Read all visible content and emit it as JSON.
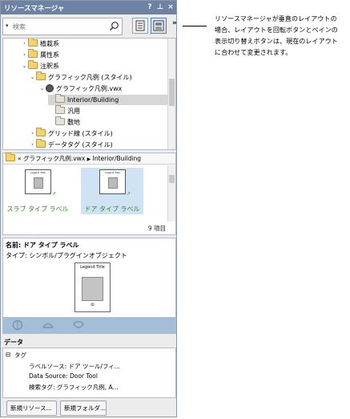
{
  "window": {
    "title": "リソースマネージャ",
    "help_label": "?",
    "pin_label": "⊥",
    "close_label": "×",
    "overflow_label": "»"
  },
  "search": {
    "dropdown_glyph": "▾",
    "placeholder": "検索",
    "value": ""
  },
  "tree": {
    "items": [
      {
        "label": "植栽系",
        "arrow": "›",
        "icon": "folder"
      },
      {
        "label": "属性系",
        "arrow": "›",
        "icon": "folder"
      },
      {
        "label": "注釈系",
        "arrow": "⌄",
        "icon": "folder"
      },
      {
        "label": "グラフィック凡例 (スタイル)",
        "arrow": "⌄",
        "icon": "folder"
      },
      {
        "label": "グラフィック凡例.vwx",
        "arrow": "⌄",
        "icon": "file"
      },
      {
        "label": "Interior/Building",
        "arrow": "",
        "icon": "folder-grey"
      },
      {
        "label": "汎用",
        "arrow": "",
        "icon": "folder-grey"
      },
      {
        "label": "敷地",
        "arrow": "",
        "icon": "folder-grey"
      },
      {
        "label": "グリッド線 (スタイル)",
        "arrow": "›",
        "icon": "folder"
      },
      {
        "label": "データタグ (スタイル)",
        "arrow": "›",
        "icon": "folder"
      }
    ]
  },
  "breadcrumb": {
    "back_glyph": "«",
    "file": "グラフィック凡例.vwx",
    "separator": "▶",
    "current": "Interior/Building"
  },
  "resources": {
    "tiles": [
      {
        "name": "スラブ タイプ ラベル",
        "thumb_caption": "Legend Title"
      },
      {
        "name": "ドア タイプ ラベル",
        "thumb_caption": "Legend Title"
      }
    ],
    "count_label": "9 項目"
  },
  "info": {
    "name_line": "名前: ドア タイプ ラベル",
    "type_line": "タイプ: シンボル/プラグインオブジェクト",
    "preview_caption": "Legend Title",
    "preview_id": "ID"
  },
  "data": {
    "heading": "データ",
    "group": "タグ",
    "group_toggle": "⊟",
    "rows": [
      "ラベルソース: ドア ツール/フィ...",
      "Data Source: Door Tool",
      "検索タグ: グラフィック凡例, A..."
    ]
  },
  "buttons": {
    "new_resource": "新規リソース...",
    "new_folder": "新規フォルダ..."
  },
  "callout": {
    "text": "リソースマネージャが垂直のレイアウトの場合、レイアウトを回転ボタンとペインの表示切り替えボタンは、現在のレイアウトに合わせて変更されます。"
  },
  "colors": {
    "titlebar": "#6e82a4",
    "selection": "#cfe3f5",
    "icon_band": "#a5bed8",
    "label_green": "#2a8a1a"
  }
}
